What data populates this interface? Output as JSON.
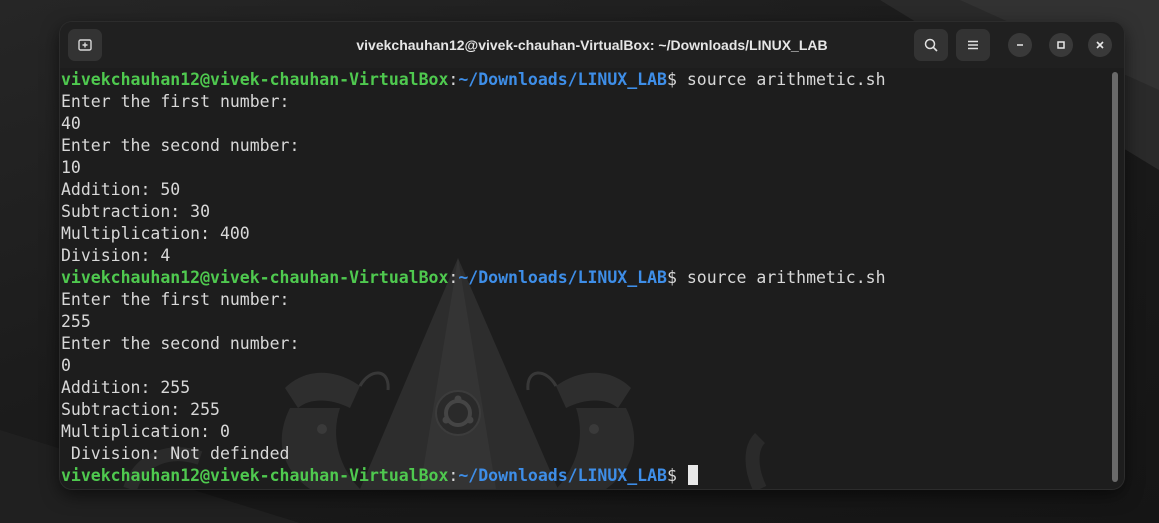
{
  "window": {
    "title": "vivekchauhan12@vivek-chauhan-VirtualBox: ~/Downloads/LINUX_LAB"
  },
  "toolbar": {
    "new_tab_icon": "new-tab-icon",
    "search_icon": "search-icon",
    "menu_icon": "hamburger-menu-icon",
    "minimize_icon": "minimize-icon",
    "maximize_icon": "maximize-icon",
    "close_icon": "close-icon"
  },
  "colors": {
    "prompt_user": "#4fc94f",
    "prompt_path": "#3e8ee8",
    "text": "#d8d8d8",
    "background": "#1e1e1e"
  },
  "terminal": {
    "prompt_user": "vivekchauhan12@vivek-chauhan-VirtualBox",
    "prompt_colon": ":",
    "prompt_path": "~/Downloads/LINUX_LAB",
    "prompt_suffix": "$ ",
    "lines": [
      {
        "type": "prompt",
        "command": "source arithmetic.sh"
      },
      {
        "type": "output",
        "text": "Enter the first number:"
      },
      {
        "type": "output",
        "text": "40"
      },
      {
        "type": "output",
        "text": "Enter the second number:"
      },
      {
        "type": "output",
        "text": "10"
      },
      {
        "type": "output",
        "text": "Addition: 50"
      },
      {
        "type": "output",
        "text": "Subtraction: 30"
      },
      {
        "type": "output",
        "text": "Multiplication: 400"
      },
      {
        "type": "output",
        "text": "Division: 4"
      },
      {
        "type": "prompt",
        "command": "source arithmetic.sh"
      },
      {
        "type": "output",
        "text": "Enter the first number:"
      },
      {
        "type": "output",
        "text": "255"
      },
      {
        "type": "output",
        "text": "Enter the second number:"
      },
      {
        "type": "output",
        "text": "0"
      },
      {
        "type": "output",
        "text": "Addition: 255"
      },
      {
        "type": "output",
        "text": "Subtraction: 255"
      },
      {
        "type": "output",
        "text": "Multiplication: 0"
      },
      {
        "type": "output",
        "text": " Division: Not definded"
      },
      {
        "type": "prompt",
        "command": "",
        "cursor": true
      }
    ]
  }
}
